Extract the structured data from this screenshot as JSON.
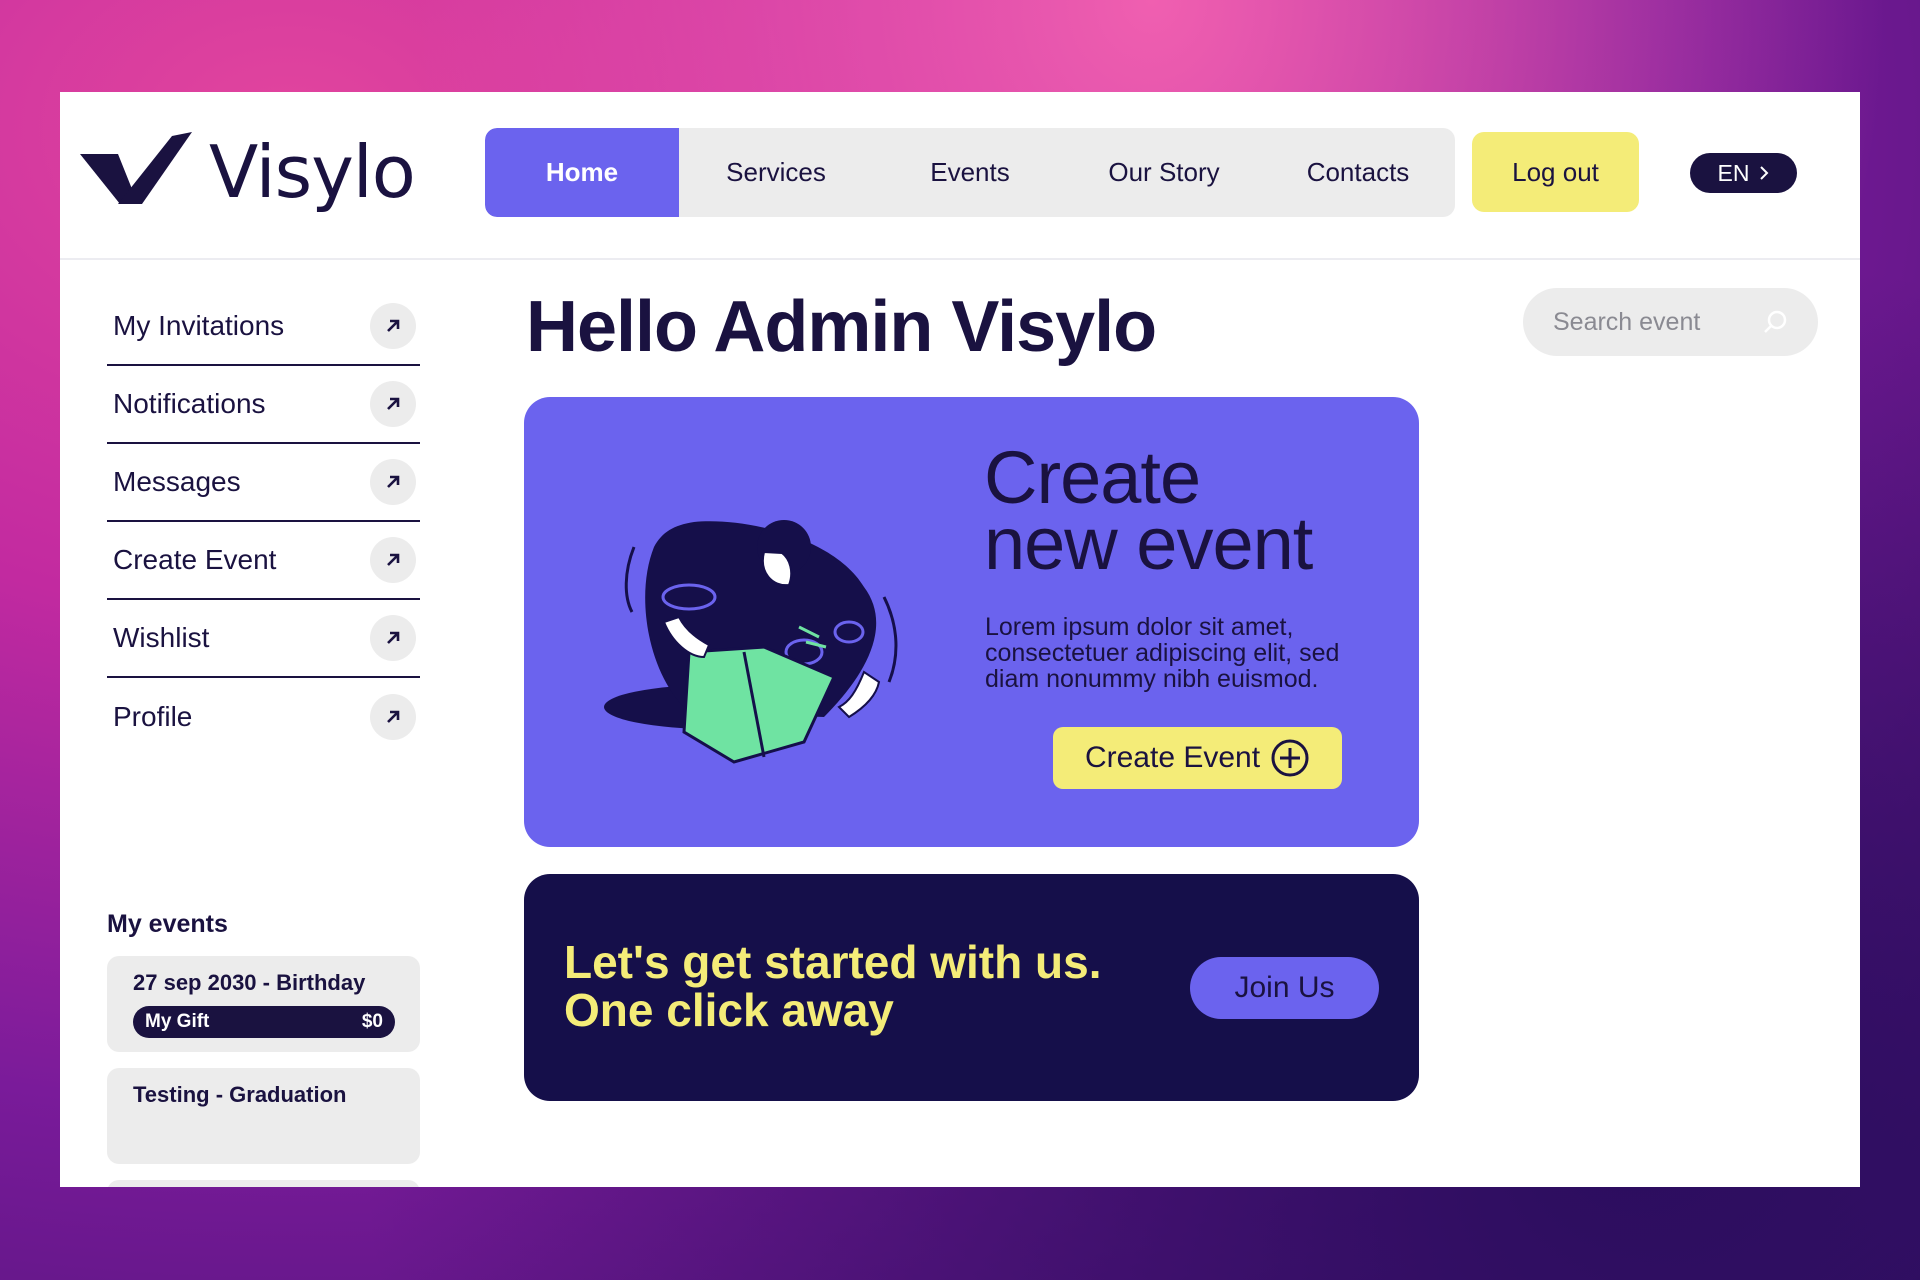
{
  "brand": {
    "name": "Visylo",
    "logo_icon": "v-check-icon"
  },
  "nav": {
    "items": [
      {
        "label": "Home",
        "active": true
      },
      {
        "label": "Services",
        "active": false
      },
      {
        "label": "Events",
        "active": false
      },
      {
        "label": "Our Story",
        "active": false
      },
      {
        "label": "Contacts",
        "active": false
      }
    ],
    "logout_label": "Log out",
    "language": "EN"
  },
  "sidebar": {
    "items": [
      {
        "label": "My Invitations",
        "icon": "arrow-up-right-icon"
      },
      {
        "label": "Notifications",
        "icon": "arrow-up-right-icon"
      },
      {
        "label": "Messages",
        "icon": "arrow-up-right-icon"
      },
      {
        "label": "Create Event",
        "icon": "arrow-up-right-icon"
      },
      {
        "label": "Wishlist",
        "icon": "arrow-up-right-icon"
      },
      {
        "label": "Profile",
        "icon": "arrow-up-right-icon"
      }
    ],
    "my_events_title": "My events",
    "events": [
      {
        "title": "27 sep 2030 - Birthday",
        "gift_label": "My Gift",
        "gift_amount": "$0"
      },
      {
        "title": "Testing - Graduation"
      }
    ]
  },
  "main": {
    "greeting": "Hello Admin Visylo",
    "search": {
      "placeholder": "Search event",
      "icon": "search-icon"
    },
    "hero": {
      "title_line1": "Create",
      "title_line2": "new event",
      "description": "Lorem ipsum dolor sit amet, consectetuer adipiscing elit, sed diam nonummy nibh euismod.",
      "button_label": "Create Event",
      "button_icon": "plus-circle-icon"
    },
    "promo": {
      "line1": "Let's get started with us.",
      "line2": "One click away",
      "button_label": "Join Us"
    }
  },
  "colors": {
    "primary": "#6b63ee",
    "dark": "#1a1240",
    "accent_yellow": "#f4ec78",
    "promo_bg": "#150f4a",
    "illustration_green": "#6fe3a2"
  }
}
